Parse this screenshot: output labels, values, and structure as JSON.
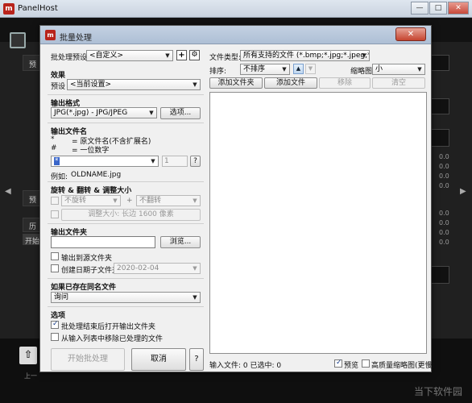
{
  "app": {
    "title": "PanelHost",
    "logo": "m",
    "minimize": "—",
    "maximize": "□",
    "close": "✕",
    "bg_labels": {
      "a": "预",
      "b": "预",
      "c": "历",
      "d": "开始",
      "e": "上一"
    },
    "bg_numbers": [
      "0.0",
      "0.0",
      "0.0",
      "0.0",
      "0.0",
      "0.0",
      "0.0",
      "0.0"
    ],
    "watermark": "当下软件园"
  },
  "dialog": {
    "title": "批量处理",
    "close": "✕",
    "left": {
      "preset_label": "批处理预设",
      "preset_value": "<自定义>",
      "add_preset": "+",
      "preset_settings": "⚙",
      "effects_title": "效果",
      "effects_preset_label": "预设",
      "effects_preset_value": "<当前设置>",
      "output_format_title": "输出格式",
      "output_format_value": "JPG(*.jpg) - JPG/JPEG",
      "output_format_options": "选项...",
      "output_filename_title": "输出文件名",
      "legend_star": "*",
      "legend_star_desc": "= 原文件名(不含扩展名)",
      "legend_hash": "#",
      "legend_hash_desc": "= 一位数字",
      "filename_pattern": "*",
      "start_number": "1",
      "help_small": "?",
      "example_label": "例如:",
      "example_value": "OLDNAME.jpg",
      "rotate_title": "旋转 & 翻转 & 调整大小",
      "rotate_value": "不旋转",
      "plus_sign": "+",
      "flip_value": "不翻转",
      "resize_button": "调整大小: 长边 1600 像素",
      "output_folder_title": "输出文件夹",
      "output_folder_value": "",
      "browse_button": "浏览...",
      "output_to_source": "输出到源文件夹",
      "create_date_folder": "创建日期子文件夹",
      "date_value": "2020-02-04",
      "if_exists_title": "如果已存在同名文件",
      "if_exists_value": "询问",
      "options_title": "选项",
      "open_folder_after": "批处理结束后打开输出文件夹",
      "remove_processed": "从输入列表中移除已处理的文件",
      "start_button": "开始批处理",
      "cancel_button": "取消",
      "help_button": "?"
    },
    "right": {
      "file_type_label": "文件类型:",
      "file_type_value": "所有支持的文件 (*.bmp;*.jpg;*.jpeg;*.png;*",
      "sort_label": "排序:",
      "sort_value": "不排序",
      "sort_asc": "▲",
      "sort_desc": "▼",
      "thumbnail_label": "缩略图:",
      "thumbnail_value": "小",
      "add_folder": "添加文件夹",
      "add_file": "添加文件",
      "remove": "移除",
      "clear": "清空",
      "status": "输入文件: 0  已选中: 0",
      "preview_label": "预览",
      "hq_thumbnails_label": "高质量缩略图(更慢)"
    }
  }
}
